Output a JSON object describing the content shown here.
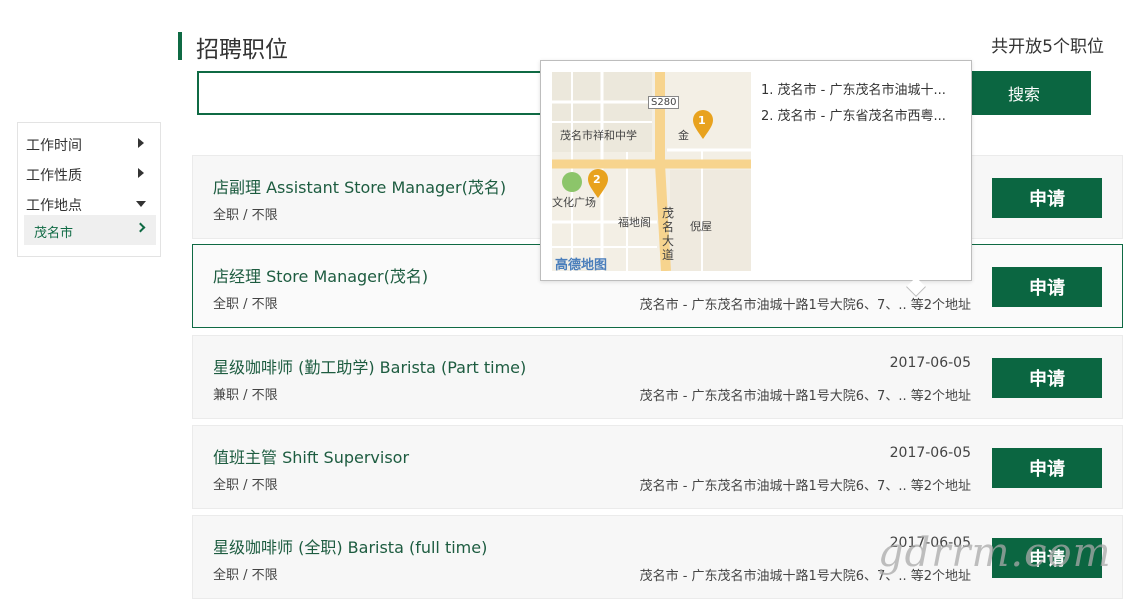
{
  "header": {
    "title": "招聘职位",
    "open_count": "共开放5个职位"
  },
  "search": {
    "value": "",
    "placeholder": "",
    "button_label": "搜索"
  },
  "sidebar": {
    "items": [
      {
        "label": "工作时间"
      },
      {
        "label": "工作性质"
      },
      {
        "label": "工作地点"
      }
    ],
    "selected_sub": "茂名市"
  },
  "jobs": [
    {
      "title": "店副理 Assistant Store Manager(茂名)",
      "meta": "全职 / 不限",
      "date": "",
      "location": "",
      "apply_label": "申请"
    },
    {
      "title": "店经理 Store Manager(茂名)",
      "meta": "全职 / 不限",
      "date": "",
      "location": "茂名市 - 广东茂名市油城十路1号大院6、7、.. 等2个地址",
      "apply_label": "申请"
    },
    {
      "title": "星级咖啡师 (勤工助学) Barista (Part time)",
      "meta": "兼职 / 不限",
      "date": "2017-06-05",
      "location": "茂名市 - 广东茂名市油城十路1号大院6、7、.. 等2个地址",
      "apply_label": "申请"
    },
    {
      "title": "值班主管 Shift Supervisor",
      "meta": "全职 / 不限",
      "date": "2017-06-05",
      "location": "茂名市 - 广东茂名市油城十路1号大院6、7、.. 等2个地址",
      "apply_label": "申请"
    },
    {
      "title": "星级咖啡师 (全职) Barista (full time)",
      "meta": "全职 / 不限",
      "date": "2017-06-05",
      "location": "茂名市 - 广东茂名市油城十路1号大院6、7、.. 等2个地址",
      "apply_label": "申请"
    }
  ],
  "map_popup": {
    "road_label": "S280",
    "labels": {
      "school": "茂名市祥和中学",
      "plaza": "文化广场",
      "fudige": "福地阁",
      "niwu": "倪屋",
      "jin": "金",
      "avenue": "茂名大道",
      "brand": "高德地图"
    },
    "marker_1": "1",
    "marker_2": "2",
    "marker_color": "#e8a21e",
    "addresses": [
      "1. 茂名市 - 广东茂名市油城十...",
      "2. 茂名市 - 广东省茂名市西粤..."
    ]
  },
  "watermark": "gdrrm.com",
  "colors": {
    "primary": "#0b6641",
    "title_text": "#1d5c40"
  }
}
